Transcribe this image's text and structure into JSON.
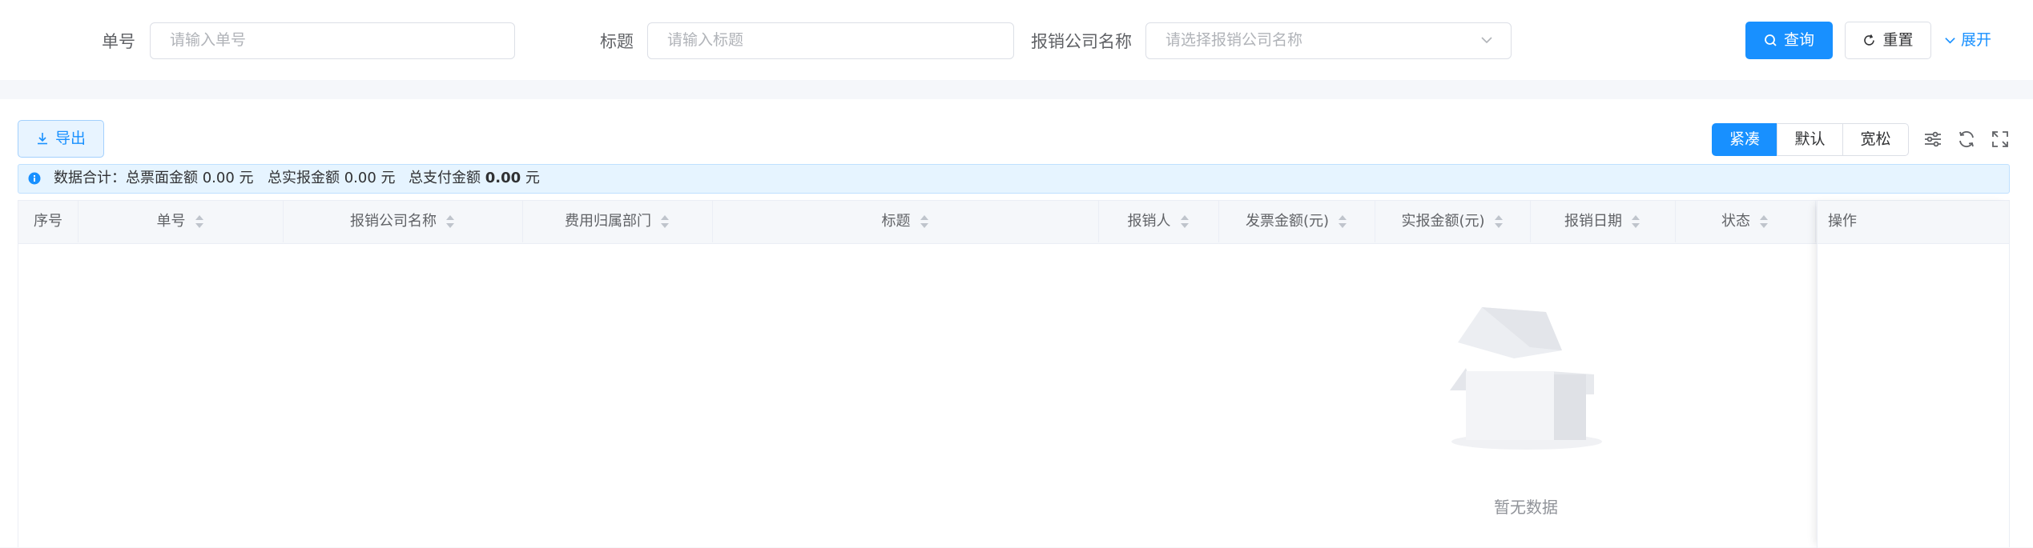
{
  "search": {
    "order_no_label": "单号",
    "order_no_placeholder": "请输入单号",
    "title_label": "标题",
    "title_placeholder": "请输入标题",
    "company_label": "报销公司名称",
    "company_placeholder": "请选择报销公司名称",
    "query_button": "查询",
    "reset_button": "重置",
    "expand_link": "展开"
  },
  "toolbar": {
    "export_button": "导出",
    "density_options": [
      "紧凑",
      "默认",
      "宽松"
    ],
    "density_selected": "紧凑"
  },
  "summary": {
    "prefix": "数据合计：总票面金额 0.00 元",
    "actual_label": "总实报金额 0.00 元",
    "paid_label": "总支付金额",
    "paid_value": "0.00",
    "paid_unit": "元"
  },
  "table": {
    "columns": [
      "序号",
      "单号",
      "报销公司名称",
      "费用归属部门",
      "标题",
      "报销人",
      "发票金额(元)",
      "实报金额(元)",
      "报销日期",
      "状态",
      "操作"
    ],
    "rows": []
  },
  "empty_text": "暂无数据",
  "colors": {
    "primary": "#1890ff",
    "info_bg": "#e6f4ff",
    "border": "#dcdfe6"
  }
}
